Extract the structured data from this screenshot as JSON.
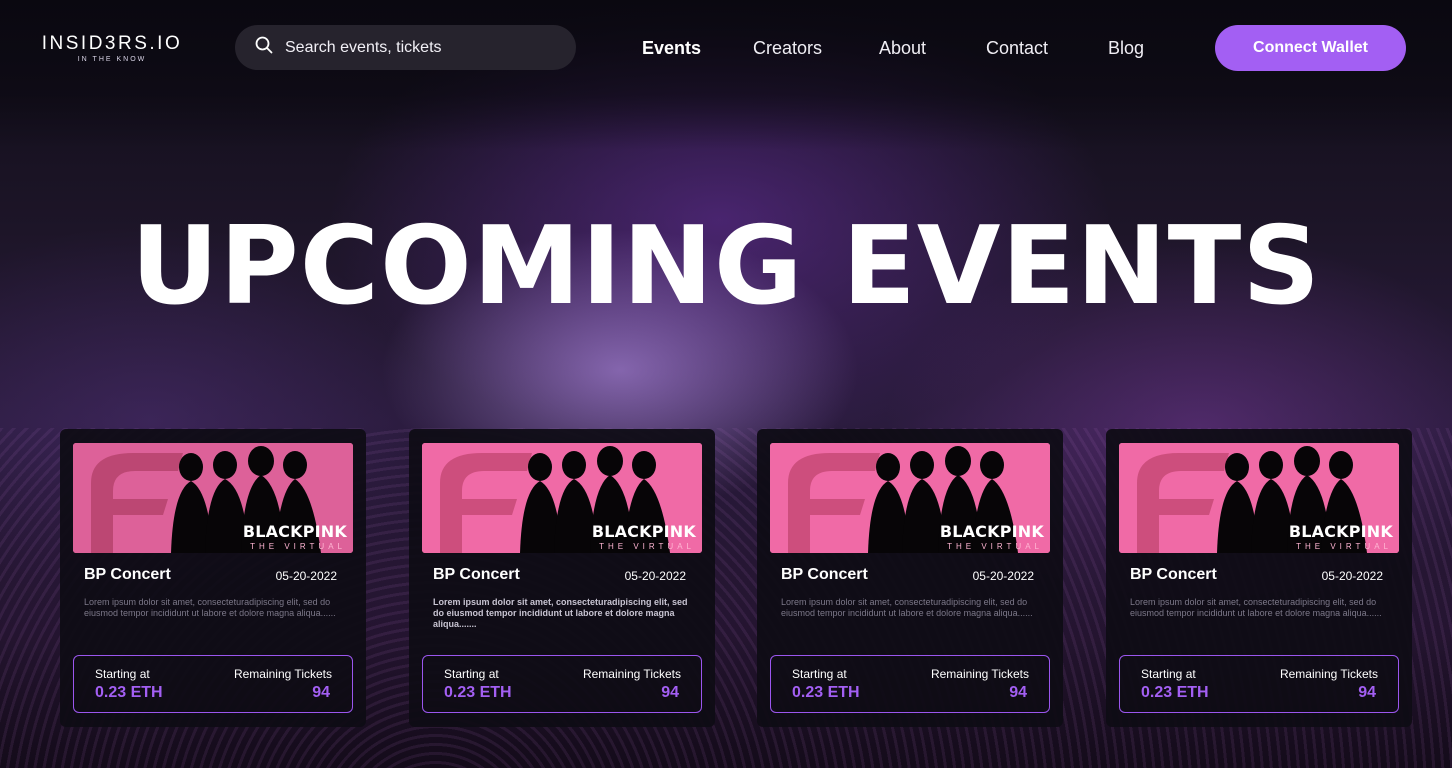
{
  "colors": {
    "accent": "#a35ff3",
    "background": "#0d0b14",
    "card_background": "#0e0c14",
    "search_background": "#26232d",
    "poster_pink": "#f06aa6"
  },
  "header": {
    "logo": {
      "name": "INSID3RS.IO",
      "tagline": "IN THE KNOW"
    },
    "search": {
      "placeholder": "Search events, tickets",
      "icon": "search-icon"
    },
    "nav": [
      {
        "label": "Events",
        "active": true
      },
      {
        "label": "Creators",
        "active": false
      },
      {
        "label": "About",
        "active": false
      },
      {
        "label": "Contact",
        "active": false
      },
      {
        "label": "Blog",
        "active": false
      }
    ],
    "connect_wallet_label": "Connect Wallet"
  },
  "hero": {
    "title": "UPCOMING EVENTS"
  },
  "events": [
    {
      "image_brand": "BLACKPINK",
      "image_sub": "THE VIRTUAL",
      "title": "BP Concert",
      "date": "05-20-2022",
      "description": "Lorem ipsum dolor sit amet, consecteturadipiscing elit, sed do eiusmod tempor incididunt ut labore et dolore magna aliqua......",
      "starting_label": "Starting at",
      "price": "0.23 ETH",
      "remaining_label": "Remaining Tickets",
      "remaining": "94"
    },
    {
      "image_brand": "BLACKPINK",
      "image_sub": "THE VIRTUAL",
      "title": "BP Concert",
      "date": "05-20-2022",
      "description": "Lorem ipsum dolor sit amet, consecteturadipiscing elit, sed do eiusmod tempor incididunt ut labore et dolore magna aliqua.......",
      "starting_label": "Starting at",
      "price": "0.23 ETH",
      "remaining_label": "Remaining Tickets",
      "remaining": "94"
    },
    {
      "image_brand": "BLACKPINK",
      "image_sub": "THE VIRTUAL",
      "title": "BP Concert",
      "date": "05-20-2022",
      "description": "Lorem ipsum dolor sit amet, consecteturadipiscing elit, sed do eiusmod tempor incididunt ut labore et dolore magna aliqua......",
      "starting_label": "Starting at",
      "price": "0.23 ETH",
      "remaining_label": "Remaining Tickets",
      "remaining": "94"
    },
    {
      "image_brand": "BLACKPINK",
      "image_sub": "THE VIRTUAL",
      "title": "BP Concert",
      "date": "05-20-2022",
      "description": "Lorem ipsum dolor sit amet, consecteturadipiscing elit, sed do eiusmod tempor incididunt ut labore et dolore magna aliqua......",
      "starting_label": "Starting at",
      "price": "0.23 ETH",
      "remaining_label": "Remaining Tickets",
      "remaining": "94"
    }
  ]
}
